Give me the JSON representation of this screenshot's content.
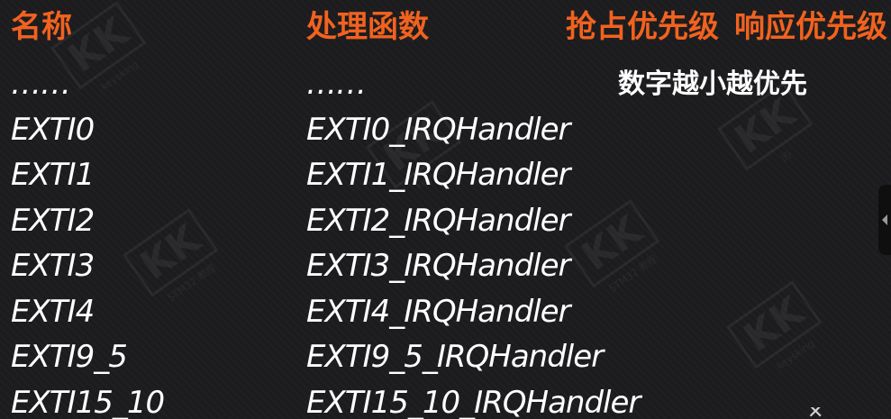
{
  "headers": {
    "name": "名称",
    "handler": "处理函数",
    "preempt": "抢占优先级",
    "response": "响应优先级"
  },
  "note": "数字越小越优先",
  "rows": [
    {
      "name": "……",
      "handler": "……"
    },
    {
      "name": "EXTI0",
      "handler": "EXTI0_IRQHandler"
    },
    {
      "name": "EXTI1",
      "handler": "EXTI1_IRQHandler"
    },
    {
      "name": "EXTI2",
      "handler": "EXTI2_IRQHandler"
    },
    {
      "name": "EXTI3",
      "handler": "EXTI3_IRQHandler"
    },
    {
      "name": "EXTI4",
      "handler": "EXTI4_IRQHandler"
    },
    {
      "name": "EXTI9_5",
      "handler": "EXTI9_5_IRQHandler"
    },
    {
      "name": "EXTI15_10",
      "handler": "EXTI15_10_IRQHandler"
    }
  ],
  "watermark": {
    "logo": "KK",
    "line1": "keysking",
    "line2": "的",
    "line3": "STM32 教程"
  },
  "colors": {
    "header": "#f2621f",
    "text": "#ffffff",
    "background": "#1c1c1e"
  },
  "icons": {
    "side_tab": "chevron-left-icon",
    "corner": "close-icon"
  }
}
